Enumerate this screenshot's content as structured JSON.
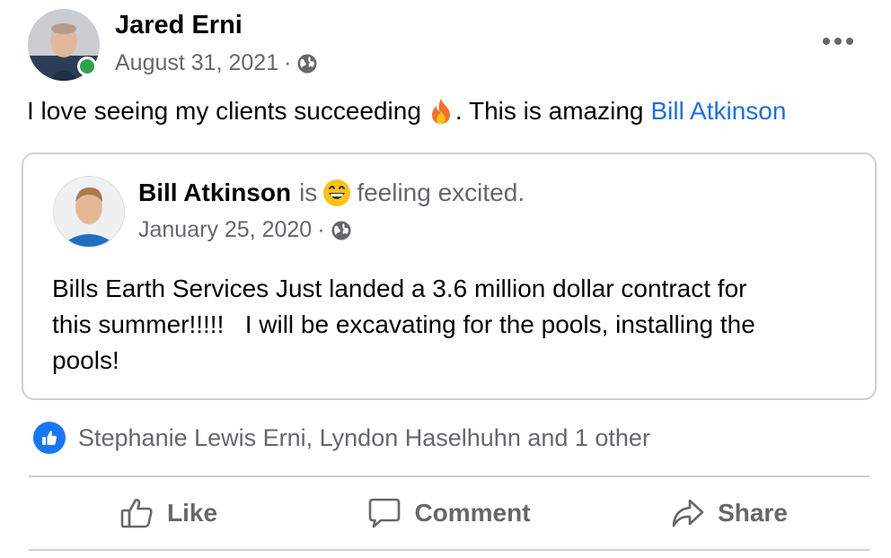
{
  "post": {
    "author": "Jared Erni",
    "date": "August 31, 2021",
    "separator": "·",
    "text_before": "I love seeing my clients succeeding",
    "text_after": ". This is amazing",
    "mention": "Bill Atkinson"
  },
  "shared": {
    "author": "Bill Atkinson",
    "is_text": "is",
    "feeling": "feeling excited.",
    "date": "January 25, 2020",
    "separator": "·",
    "body": "Bills Earth Services Just landed a 3.6 million dollar contract for\nthis summer!!!!!   I will be excavating for the pools, installing the\npools!"
  },
  "reactions": {
    "text": "Stephanie Lewis Erni, Lyndon Haselhuhn and 1 other"
  },
  "actions": {
    "like": "Like",
    "comment": "Comment",
    "share": "Share"
  },
  "icons": {
    "visibility": "globe-icon",
    "more": "more-options-icon",
    "emoji_post": "fire-icon",
    "emoji_feeling": "grinning-face-icon",
    "reaction": "like-badge-icon"
  },
  "colors": {
    "link": "#216fdb",
    "secondary_text": "#65676b",
    "online": "#31a24c",
    "like_badge": "#1877f2"
  }
}
